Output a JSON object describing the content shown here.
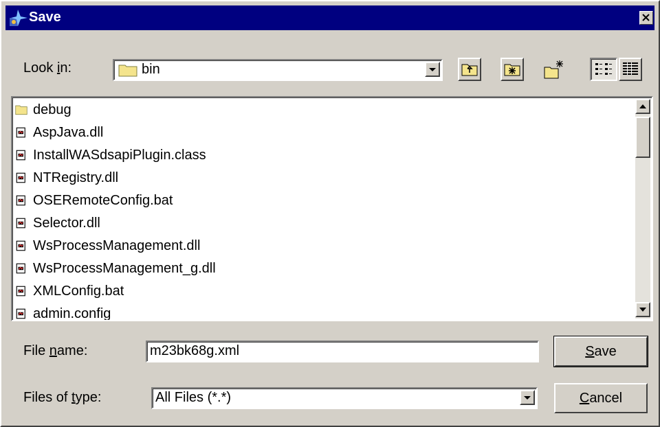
{
  "window": {
    "title": "Save"
  },
  "look_in": {
    "label_prefix": "Look ",
    "label_accel": "i",
    "label_suffix": "n:",
    "value": "bin"
  },
  "toolbar": {
    "up_icon": "up-one-level-icon",
    "home_icon": "home-folder-icon",
    "new_folder_icon": "new-folder-icon",
    "list_view_icon": "list-view-icon",
    "details_view_icon": "details-view-icon"
  },
  "files": [
    {
      "name": "debug",
      "type": "folder"
    },
    {
      "name": "AspJava.dll",
      "type": "file"
    },
    {
      "name": "InstallWASdsapiPlugin.class",
      "type": "file"
    },
    {
      "name": "NTRegistry.dll",
      "type": "file"
    },
    {
      "name": "OSERemoteConfig.bat",
      "type": "file"
    },
    {
      "name": "Selector.dll",
      "type": "file"
    },
    {
      "name": "WsProcessManagement.dll",
      "type": "file"
    },
    {
      "name": "WsProcessManagement_g.dll",
      "type": "file"
    },
    {
      "name": "XMLConfig.bat",
      "type": "file"
    },
    {
      "name": "admin.config",
      "type": "file"
    }
  ],
  "file_name": {
    "label_prefix": "File ",
    "label_accel": "n",
    "label_suffix": "ame:",
    "value": "m23bk68g.xml"
  },
  "file_type": {
    "label_prefix": "Files of ",
    "label_accel": "t",
    "label_suffix": "ype:",
    "value": "All Files (*.*)"
  },
  "buttons": {
    "save_accel": "S",
    "save_rest": "ave",
    "cancel_accel": "C",
    "cancel_rest": "ancel"
  },
  "colors": {
    "titlebar": "#000080",
    "face": "#d4d0c8",
    "folder": "#f4e48c"
  }
}
